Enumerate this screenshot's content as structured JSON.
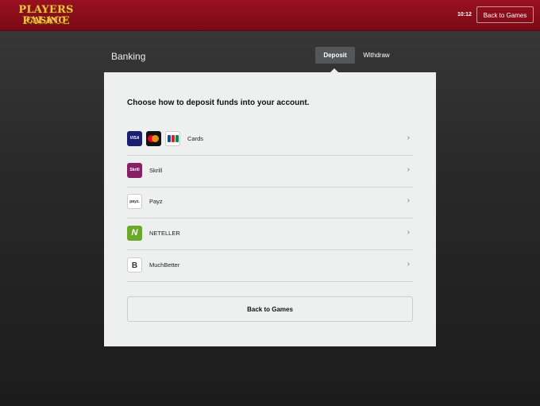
{
  "header": {
    "logo_line1": "PLAYERS PALACE",
    "logo_line2": "CASINO",
    "clock": "10:12",
    "back_label": "Back to Games"
  },
  "banking": {
    "title": "Banking",
    "tabs": [
      {
        "label": "Deposit",
        "active": true
      },
      {
        "label": "Withdraw",
        "active": false
      }
    ]
  },
  "panel": {
    "heading": "Choose how to deposit funds into your account.",
    "methods": [
      {
        "label": "Cards",
        "icons": [
          "visa-icon",
          "mastercard-icon",
          "jcb-icon"
        ]
      },
      {
        "label": "Skrill",
        "icons": [
          "skrill-icon"
        ]
      },
      {
        "label": "Payz",
        "icons": [
          "payz-icon"
        ]
      },
      {
        "label": "NETELLER",
        "icons": [
          "neteller-icon"
        ]
      },
      {
        "label": "MuchBetter",
        "icons": [
          "muchbetter-icon"
        ]
      }
    ],
    "chevron": "›",
    "back_label": "Back to Games"
  },
  "icon_text": {
    "visa": "VISA",
    "skrill": "Skrill",
    "payz": "payz.",
    "neteller": "N",
    "muchbetter": "B"
  },
  "colors": {
    "header_red": "#8b0d1c",
    "logo_gold": "#f3c23e",
    "active_tab": "#555659",
    "panel_bg": "#eef0f0"
  }
}
